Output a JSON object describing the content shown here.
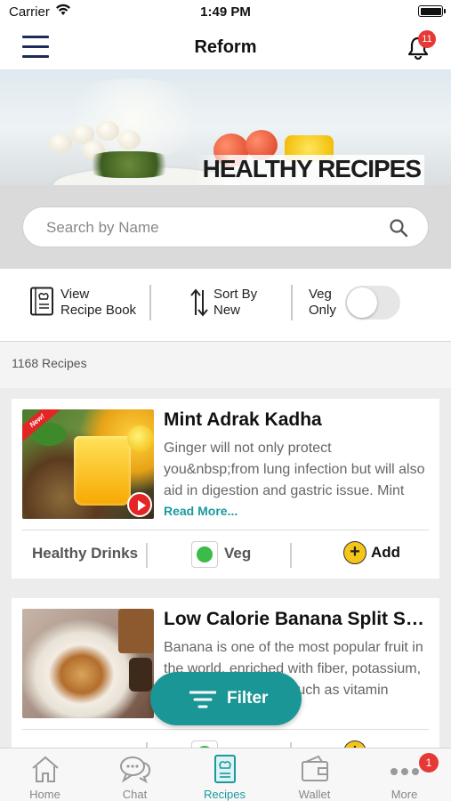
{
  "status_bar": {
    "carrier": "Carrier",
    "time": "1:49 PM"
  },
  "header": {
    "title": "Reform",
    "notification_count": "11"
  },
  "banner": {
    "headline": "HEALTHY RECIPES"
  },
  "search": {
    "placeholder": "Search by Name"
  },
  "toolbar": {
    "view_line1": "View",
    "view_line2": "Recipe Book",
    "sort_line1": "Sort By",
    "sort_line2": "New",
    "veg_line1": "Veg",
    "veg_line2": "Only",
    "veg_only_on": false
  },
  "recipe_count": "1168 Recipes",
  "recipes": [
    {
      "title": "Mint Adrak Kadha",
      "description": "Ginger will not only protect you&nbsp;from lung infection but will also aid in digestion and gastric issue. Mint",
      "read_more": "Read More...",
      "badge": "New!",
      "category": "Healthy Drinks",
      "diet": "Veg",
      "add_label": "Add"
    },
    {
      "title": "Low Calorie Banana Split Su...",
      "description": "Banana is one of the most popular fruit in the world, enriched with fiber, potassium, and other nutrients, such as vitamin"
    }
  ],
  "filter": {
    "label": "Filter"
  },
  "tabs": [
    {
      "label": "Home",
      "icon": "home-icon"
    },
    {
      "label": "Chat",
      "icon": "chat-icon"
    },
    {
      "label": "Recipes",
      "icon": "recipes-icon",
      "active": true
    },
    {
      "label": "Wallet",
      "icon": "wallet-icon"
    },
    {
      "label": "More",
      "icon": "more-icon",
      "badge": "1"
    }
  ],
  "colors": {
    "accent": "#1a9aa0",
    "filter_bg": "#1a9696",
    "badge": "#e53935",
    "nav_icon": "#1f2a55"
  }
}
